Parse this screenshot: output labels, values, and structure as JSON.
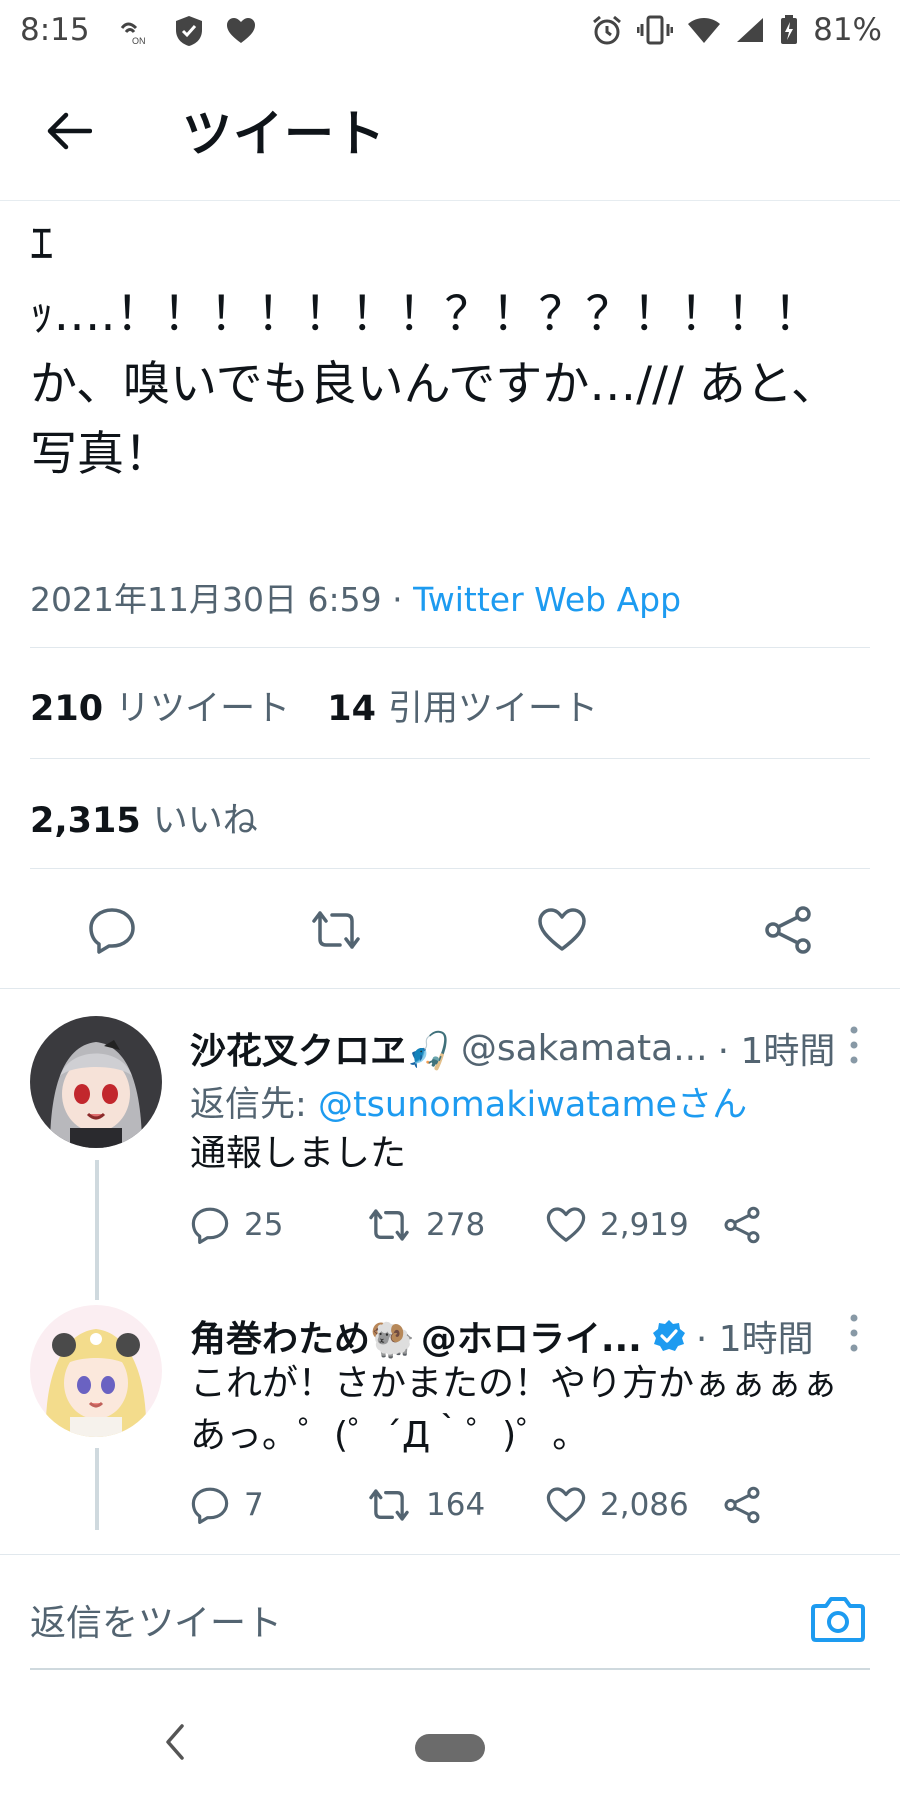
{
  "status_bar": {
    "time": "8:15",
    "battery": "81%",
    "icons_left": [
      "nfc-on-icon",
      "shield-check-icon",
      "heart-icon"
    ],
    "icons_right": [
      "alarm-icon",
      "vibrate-icon",
      "wifi-icon",
      "signal-icon",
      "battery-charging-icon"
    ]
  },
  "header": {
    "title": "ツイート",
    "back_icon": "arrow-left-icon"
  },
  "tweet": {
    "text": "ｴ\nｯ….！！！！！！！？！？？！！！！\nか、嗅いでも良いんですか…/// あと、写真！",
    "timestamp": "2021年11月30日 6:59",
    "separator": "·",
    "via": "Twitter Web App",
    "retweets_count": "210",
    "retweets_label": "リツイート",
    "quotes_count": "14",
    "quotes_label": "引用ツイート",
    "likes_count": "2,315",
    "likes_label": "いいね"
  },
  "replies": [
    {
      "name": "沙花叉クロヱ🎣",
      "handle": "@sakamata...",
      "time": "· 1時間",
      "reply_to_label": "返信先:",
      "reply_to_user": "@tsunomakiwatame",
      "reply_to_suffix": "さん",
      "text": "通報しました",
      "replies": "25",
      "retweets": "278",
      "likes": "2,919"
    },
    {
      "name": "角巻わため🐏",
      "handle": "@ホロライ...",
      "verified": true,
      "time": "· 1時間",
      "text": "これが！さかまたの！やり方かぁぁぁぁあっ。゜(゜´Д｀゜)゜。",
      "replies": "7",
      "retweets": "164",
      "likes": "2,086"
    }
  ],
  "compose": {
    "placeholder": "返信をツイート"
  },
  "colors": {
    "accent": "#1d9bf0",
    "text_primary": "#0f1419",
    "text_secondary": "#536471",
    "divider": "#e1e8ed"
  }
}
